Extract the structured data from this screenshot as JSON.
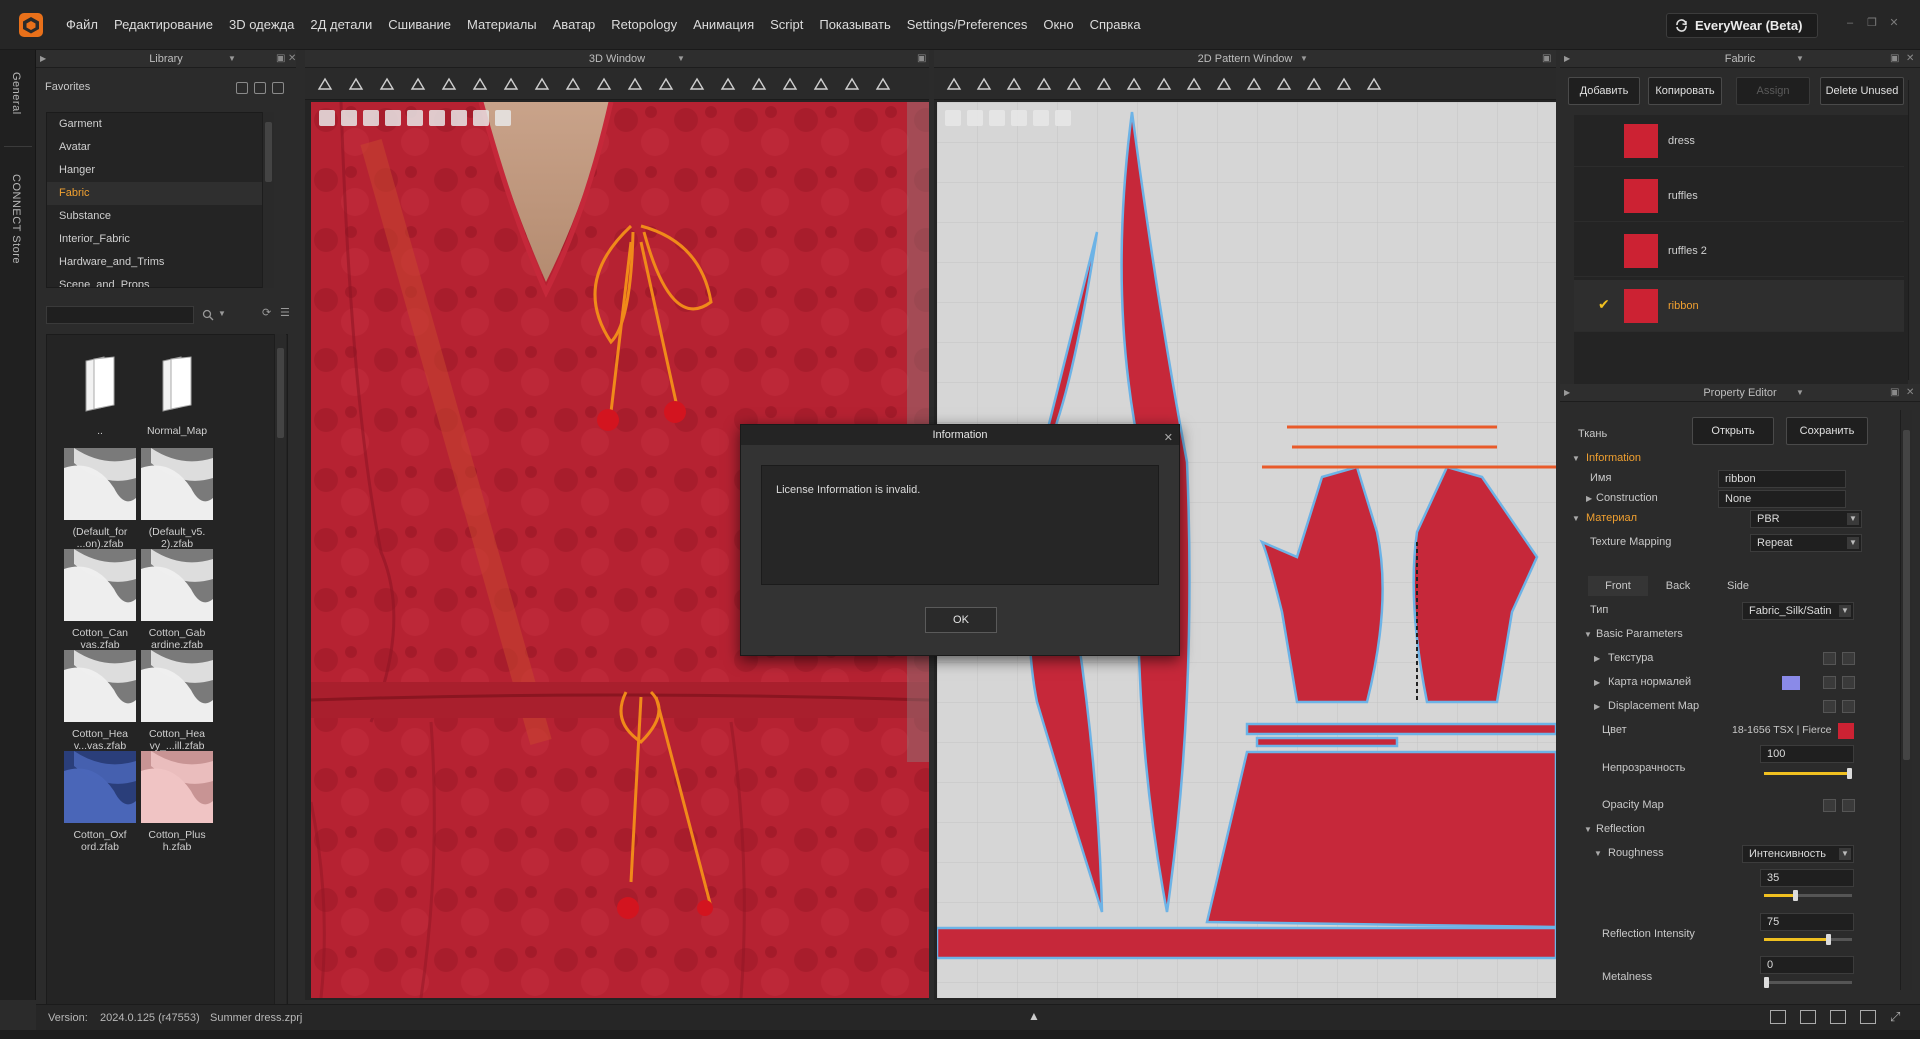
{
  "menu": {
    "items": [
      "Файл",
      "Редактирование",
      "3D одежда",
      "2Д детали",
      "Сшивание",
      "Материалы",
      "Аватар",
      "Retopology",
      "Анимация",
      "Script",
      "Показывать",
      "Settings/Preferences",
      "Окно",
      "Справка"
    ],
    "product_badge": "EveryWear (Beta)"
  },
  "side_tabs": {
    "general": "General",
    "connect": "CONNECT Store"
  },
  "library": {
    "title": "Library",
    "favorites": "Favorites",
    "items": [
      "Garment",
      "Avatar",
      "Hanger",
      "Fabric",
      "Substance",
      "Interior_Fabric",
      "Hardware_and_Trims",
      "Scene_and_Props"
    ],
    "active_item": "Fabric",
    "thumbnails": [
      {
        "label": "..",
        "kind": "folder"
      },
      {
        "label": "Normal_Map",
        "kind": "folder"
      },
      {
        "label": "(Default_for ...on).zfab",
        "kind": "white"
      },
      {
        "label": "(Default_v5. 2).zfab",
        "kind": "white"
      },
      {
        "label": "Cotton_Can vas.zfab",
        "kind": "white"
      },
      {
        "label": "Cotton_Gab ardine.zfab",
        "kind": "white"
      },
      {
        "label": "Cotton_Hea v...vas.zfab",
        "kind": "white"
      },
      {
        "label": "Cotton_Hea vy_...ill.zfab",
        "kind": "white"
      },
      {
        "label": "Cotton_Oxf ord.zfab",
        "kind": "blue"
      },
      {
        "label": "Cotton_Plus h.zfab",
        "kind": "pink"
      }
    ]
  },
  "window3d": {
    "title": "3D Window"
  },
  "window2d": {
    "title": "2D Pattern Window"
  },
  "fabric_panel": {
    "title": "Fabric",
    "buttons": {
      "add": "Добавить",
      "copy": "Копировать",
      "assign": "Assign",
      "delete_unused": "Delete Unused"
    },
    "fabrics": [
      {
        "name": "dress",
        "selected": false
      },
      {
        "name": "ruffles",
        "selected": false
      },
      {
        "name": "ruffles 2",
        "selected": false
      },
      {
        "name": "ribbon",
        "selected": true
      }
    ],
    "swatch_color": "#cc2233"
  },
  "property_editor": {
    "title": "Property Editor",
    "section_label": "Ткань",
    "open_btn": "Открыть",
    "save_btn": "Сохранить",
    "information": "Information",
    "name_label": "Имя",
    "name_value": "ribbon",
    "construction_label": "Construction",
    "construction_value": "None",
    "material_label": "Материал",
    "material_value": "PBR",
    "texture_mapping_label": "Texture Mapping",
    "texture_mapping_value": "Repeat",
    "tabs": [
      "Front",
      "Back",
      "Side"
    ],
    "type_label": "Тип",
    "type_value": "Fabric_Silk/Satin",
    "basic_params": "Basic Parameters",
    "texture": "Текстура",
    "normal_map": "Карта нормалей",
    "displacement_map": "Displacement Map",
    "color_label": "Цвет",
    "color_value": "18-1656 TSX | Fierce",
    "opacity_label": "Непрозрачность",
    "opacity_value": "100",
    "opacity_map": "Opacity Map",
    "reflection": "Reflection",
    "roughness_label": "Roughness",
    "roughness_mode": "Интенсивность",
    "roughness_value": "35",
    "reflection_intensity_label": "Reflection Intensity",
    "reflection_intensity_value": "75",
    "metalness_label": "Metalness",
    "metalness_value": "0",
    "accent_color": "#f0a030",
    "normal_map_color": "#8a8ae8"
  },
  "status": {
    "version_label": "Version:",
    "version_value": "2024.0.125 (r47553)",
    "file_name": "Summer dress.zprj"
  },
  "dialog": {
    "title": "Information",
    "message": "License Information is invalid.",
    "ok": "OK"
  }
}
